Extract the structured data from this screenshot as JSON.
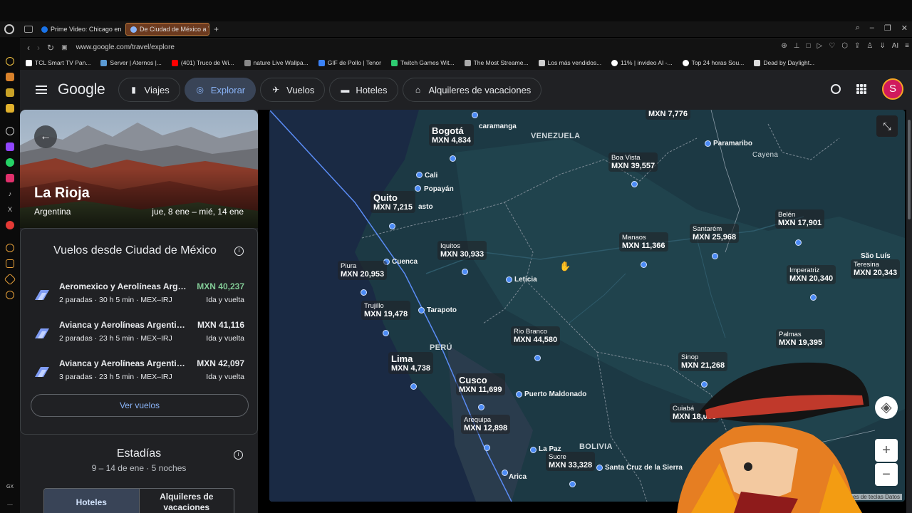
{
  "browser": {
    "tabs": [
      {
        "label": "Prime Video: Chicago en fu",
        "color": "#1a73e8"
      },
      {
        "label": "De Ciudad de México a Ta",
        "color": "#8ab4f8"
      }
    ],
    "url": "www.google.com/travel/explore",
    "bookmarks": [
      {
        "label": "TCL Smart TV Pan...",
        "color": "#ffffff"
      },
      {
        "label": "Server | Aternos |...",
        "color": "#5b9bd5"
      },
      {
        "label": "(401) Truco de Wi...",
        "color": "#ff0000"
      },
      {
        "label": "nature Live Wallpa...",
        "color": "#888888"
      },
      {
        "label": "GIF de Pollo | Tenor",
        "color": "#3b82f6"
      },
      {
        "label": "Twitch Games Wit...",
        "color": "#2ecc71"
      },
      {
        "label": "The Most Streame...",
        "color": "#aaaaaa"
      },
      {
        "label": "Los más vendidos...",
        "color": "#cccccc"
      },
      {
        "label": "11% | invideo AI -...",
        "color": "#ffffff"
      },
      {
        "label": "Top 24 horas Sou...",
        "color": "#ffffff"
      },
      {
        "label": "Dead by Daylight...",
        "color": "#dddddd"
      }
    ]
  },
  "header": {
    "logo": "Google",
    "nav": [
      {
        "label": "Viajes",
        "icon": "suitcase-icon",
        "active": false
      },
      {
        "label": "Explorar",
        "icon": "explore-icon",
        "active": true
      },
      {
        "label": "Vuelos",
        "icon": "plane-icon",
        "active": false
      },
      {
        "label": "Hoteles",
        "icon": "bed-icon",
        "active": false
      },
      {
        "label": "Alquileres de vacaciones",
        "icon": "house-icon",
        "active": false
      }
    ],
    "avatar_letter": "S"
  },
  "destination": {
    "name": "La Rioja",
    "country": "Argentina",
    "dates": "jue, 8 ene – mié, 14 ene"
  },
  "flights": {
    "title": "Vuelos desde Ciudad de México",
    "items": [
      {
        "airline": "Aeromexico y Aerolíneas Argentinas",
        "detail": "2 paradas · 30 h 5 min · MEX–IRJ",
        "price": "MXN 40,237",
        "trip": "Ida y vuelta",
        "cheapest": true
      },
      {
        "airline": "Avianca y Aerolíneas Argentinas",
        "detail": "2 paradas · 23 h 5 min · MEX–IRJ",
        "price": "MXN 41,116",
        "trip": "Ida y vuelta",
        "cheapest": false
      },
      {
        "airline": "Avianca y Aerolíneas Argentinas",
        "detail": "3 paradas · 23 h 5 min · MEX–IRJ",
        "price": "MXN 42,097",
        "trip": "Ida y vuelta",
        "cheapest": false
      }
    ],
    "see_flights": "Ver vuelos"
  },
  "stays": {
    "title": "Estadías",
    "subtitle": "9 – 14 de ene · 5 noches",
    "tabs": [
      "Hoteles",
      "Alquileres de vacaciones"
    ]
  },
  "map": {
    "price_labels": [
      {
        "city": "",
        "price": "MXN 7,776"
      },
      {
        "city": "Bogotá",
        "price": "MXN 4,834"
      },
      {
        "city": "Boa Vista",
        "price": "MXN 39,557"
      },
      {
        "city": "Quito",
        "price": "MXN 7,215"
      },
      {
        "city": "Belén",
        "price": "MXN 17,901"
      },
      {
        "city": "Santarém",
        "price": "MXN 25,968"
      },
      {
        "city": "Manaos",
        "price": "MXN 11,366"
      },
      {
        "city": "Iquitos",
        "price": "MXN 30,933"
      },
      {
        "city": "Piura",
        "price": "MXN 20,953"
      },
      {
        "city": "Imperatriz",
        "price": "MXN 20,340"
      },
      {
        "city": "Teresina",
        "price": "MXN 20,343"
      },
      {
        "city": "Trujillo",
        "price": "MXN 19,478"
      },
      {
        "city": "Rio Branco",
        "price": "MXN 44,580"
      },
      {
        "city": "Palmas",
        "price": "MXN 19,395"
      },
      {
        "city": "Lima",
        "price": "MXN 4,738"
      },
      {
        "city": "Sinop",
        "price": "MXN 21,268"
      },
      {
        "city": "Cusco",
        "price": "MXN 11,699"
      },
      {
        "city": "Cuiabá",
        "price": "MXN 18,068"
      },
      {
        "city": "Arequipa",
        "price": "MXN 12,898"
      },
      {
        "city": "Sucre",
        "price": "MXN 33,328"
      }
    ],
    "town_labels": [
      "caramanga",
      "Paramaribo",
      "Cali",
      "Popayán",
      "asto",
      "Cuenca",
      "Leticia",
      "Tarapoto",
      "Puerto Maldonado",
      "La Paz",
      "Arica",
      "Santa Cruz de la Sierra",
      "São Luís"
    ],
    "country_labels": [
      "VENEZUELA",
      "Cayena",
      "PERÚ",
      "BOLIVIA"
    ],
    "attribution": "Combinaciones de teclas  Datos"
  }
}
